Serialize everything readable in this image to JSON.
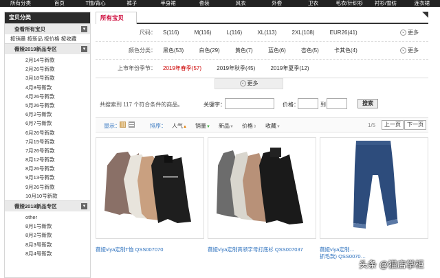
{
  "nav": {
    "items": [
      "所有分类",
      "首页",
      "T恤/背心",
      "裤子",
      "半身裙",
      "套装",
      "风衣",
      "外套",
      "卫衣",
      "毛衣/针织衫",
      "衬衫/雪纺",
      "连衣裙"
    ]
  },
  "sidebar": {
    "title": "宝贝分类",
    "view_all": "查看所有宝贝",
    "sort_links": "按销量  按新品  按价格  按收藏",
    "group1": {
      "title": "薇娅2019新品专区",
      "items": [
        "2月14号新款",
        "2月26号新款",
        "3月18号新款",
        "4月8号新款",
        "4月26号新款",
        "5月26号新款",
        "6月2号新款",
        "6月7号新款",
        "6月26号新款",
        "7月15号新款",
        "7月26号新款",
        "8月12号新款",
        "8月26号新款",
        "9月13号新款",
        "9月26号新款",
        "10月10号新款"
      ]
    },
    "group2": {
      "title": "薇娅2018新品专区",
      "items": [
        "other",
        "8月1号新款",
        "8月2号新款",
        "8月3号新款",
        "8月4号新款"
      ]
    },
    "toggle_glyph": "▾"
  },
  "main": {
    "tab_title": "所有宝贝",
    "filters": [
      {
        "label": "尺码：",
        "values": [
          "S(116)",
          "M(116)",
          "L(116)",
          "XL(113)",
          "2XL(108)",
          "EUR26(41)"
        ],
        "more": "更多"
      },
      {
        "label": "颜色分类：",
        "values": [
          "黑色(53)",
          "白色(29)",
          "黄色(7)",
          "蓝色(6)",
          "杏色(5)",
          "卡其色(4)"
        ],
        "more": "更多"
      },
      {
        "label": "上市年份季节：",
        "values": [
          "2019年春季(57)",
          "2019年秋季(45)",
          "2019年夏季(12)"
        ],
        "more": ""
      }
    ],
    "more_button": "更多",
    "search": {
      "count_text": "共搜索到 117 个符合条件的商品。",
      "keyword_label": "关键字：",
      "price_label": "价格：",
      "to": "到",
      "button": "搜索"
    },
    "sortbar": {
      "display_label": "显示：",
      "sort_label": "排序：",
      "options": [
        "人气",
        "销量",
        "新品",
        "价格",
        "收藏"
      ],
      "page_info": "1/5",
      "prev": "上一页",
      "next": "下一页"
    },
    "products": [
      {
        "name": "薇娅viya定制T恤 QSS007070",
        "name2": ""
      },
      {
        "name": "薇娅viya定制高领字母打底衫 QSS007037",
        "name2": ""
      },
      {
        "name": "薇娅viya定制…",
        "name2": "抓毛款) QSS0070…"
      }
    ]
  },
  "watermark": "头条 @猫店掌柜",
  "colors": {
    "nav_bg": "#222222",
    "accent_red": "#cc0033",
    "link_blue": "#2a6fbd"
  }
}
